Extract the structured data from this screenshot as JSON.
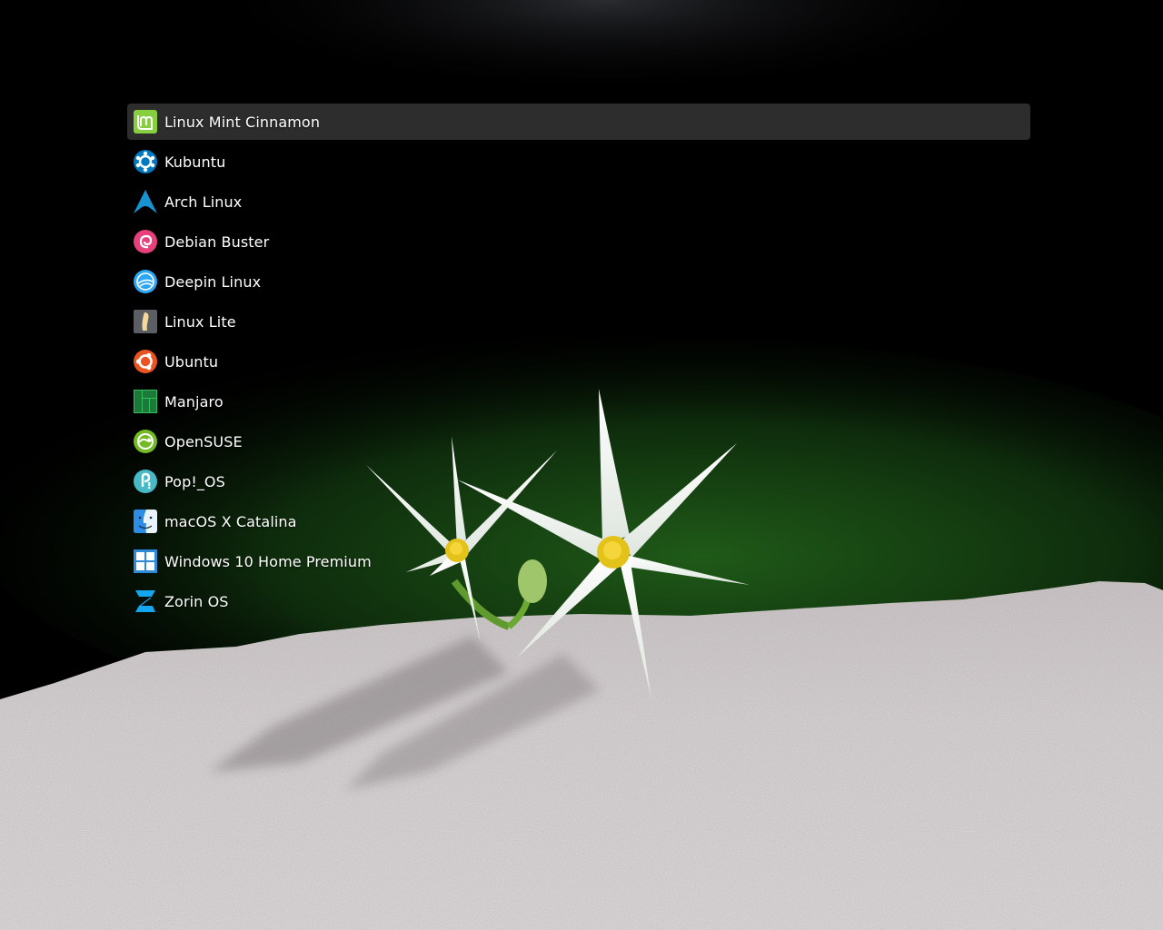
{
  "boot_menu": {
    "entries": [
      {
        "label": "Linux Mint Cinnamon",
        "icon": "linux-mint-icon",
        "selected": true
      },
      {
        "label": "Kubuntu",
        "icon": "kubuntu-icon"
      },
      {
        "label": "Arch Linux",
        "icon": "arch-linux-icon"
      },
      {
        "label": "Debian Buster",
        "icon": "debian-icon"
      },
      {
        "label": "Deepin Linux",
        "icon": "deepin-icon"
      },
      {
        "label": "Linux Lite",
        "icon": "linux-lite-icon"
      },
      {
        "label": "Ubuntu",
        "icon": "ubuntu-icon"
      },
      {
        "label": "Manjaro",
        "icon": "manjaro-icon"
      },
      {
        "label": "OpenSUSE",
        "icon": "opensuse-icon"
      },
      {
        "label": "Pop!_OS",
        "icon": "pop-os-icon"
      },
      {
        "label": "macOS X Catalina",
        "icon": "macos-finder-icon"
      },
      {
        "label": "Windows 10 Home Premium",
        "icon": "windows-icon"
      },
      {
        "label": "Zorin OS",
        "icon": "zorin-icon"
      }
    ]
  },
  "background": {
    "subject": "white-lily-flowers-on-stone",
    "colors": {
      "sky": "#000000",
      "foliage": "#0f3a12",
      "stone": "#d9d5d3"
    }
  }
}
